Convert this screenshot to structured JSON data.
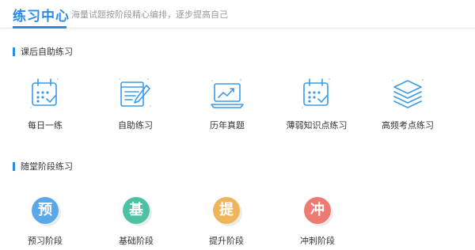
{
  "header": {
    "title": "练习中心",
    "subtitle": "海量试题按阶段精心编排，逐步提高自己"
  },
  "section_after_class": {
    "title": "课后自助练习",
    "items": [
      {
        "label": "每日一练",
        "icon": "calendar-check-icon"
      },
      {
        "label": "自助练习",
        "icon": "document-pen-icon"
      },
      {
        "label": "历年真题",
        "icon": "laptop-chart-icon"
      },
      {
        "label": "薄弱知识点练习",
        "icon": "calendar-check-icon"
      },
      {
        "label": "高频考点练习",
        "icon": "stacked-layers-icon"
      }
    ]
  },
  "section_stage": {
    "title": "随堂阶段练习",
    "items": [
      {
        "label": "预习阶段",
        "char": "预",
        "color": "#5ba8e8"
      },
      {
        "label": "基础阶段",
        "char": "基",
        "color": "#4cc2a3"
      },
      {
        "label": "提升阶段",
        "char": "提",
        "color": "#f0b55a"
      },
      {
        "label": "冲刺阶段",
        "char": "冲",
        "color": "#ee7b72"
      }
    ]
  },
  "colors": {
    "accent": "#2b8be6",
    "icon_blue": "#3a9be6"
  }
}
